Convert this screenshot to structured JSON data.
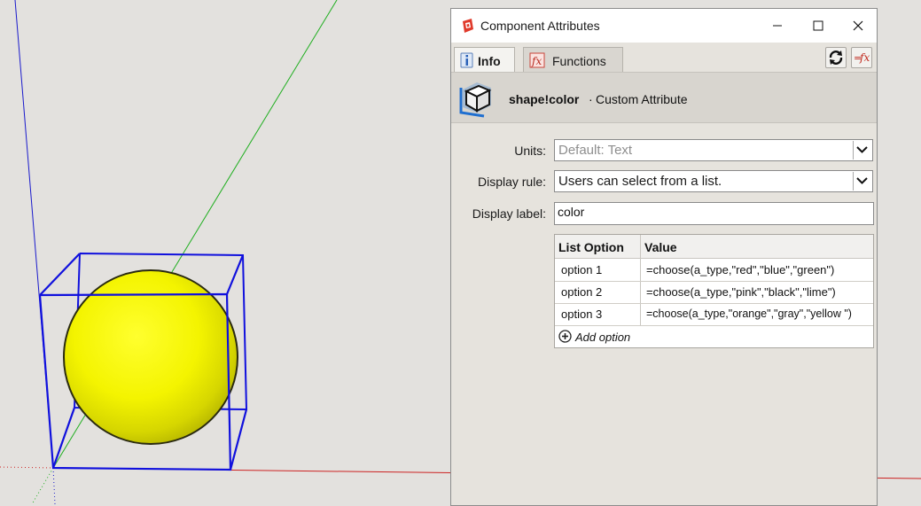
{
  "window": {
    "title": "Component Attributes",
    "controls": [
      "minimize-icon",
      "maximize-icon",
      "close-icon"
    ]
  },
  "tabs": [
    {
      "label": "Info",
      "icon": "info-icon",
      "active": true
    },
    {
      "label": "Functions",
      "icon": "fx-icon",
      "active": false
    }
  ],
  "toolbar": {
    "refresh_icon": "refresh-icon",
    "formula_icon": "formula-fx-icon"
  },
  "header": {
    "name": "shape!color",
    "separator": "·",
    "type": "Custom Attribute"
  },
  "form": {
    "units_label": "Units:",
    "units_value": "Default: Text",
    "display_rule_label": "Display rule:",
    "display_rule_value": "Users can select from a list.",
    "display_label_label": "Display label:",
    "display_label_value": "color"
  },
  "options_table": {
    "columns": [
      "List Option",
      "Value"
    ],
    "rows": [
      {
        "option": "option 1",
        "value": "=choose(a_type,\"red\",\"blue\",\"green\")"
      },
      {
        "option": "option 2",
        "value": "=choose(a_type,\"pink\",\"black\",\"lime\")"
      },
      {
        "option": "option 3",
        "value": "=choose(a_type,\"orange\",\"gray\",\"yellow \")"
      }
    ],
    "add_label": "Add option"
  },
  "colors": {
    "sphere": "#f7f700",
    "bbox": "#1010dd",
    "axis_red": "#cc2020",
    "axis_green": "#20b020",
    "axis_blue": "#2020cc"
  }
}
